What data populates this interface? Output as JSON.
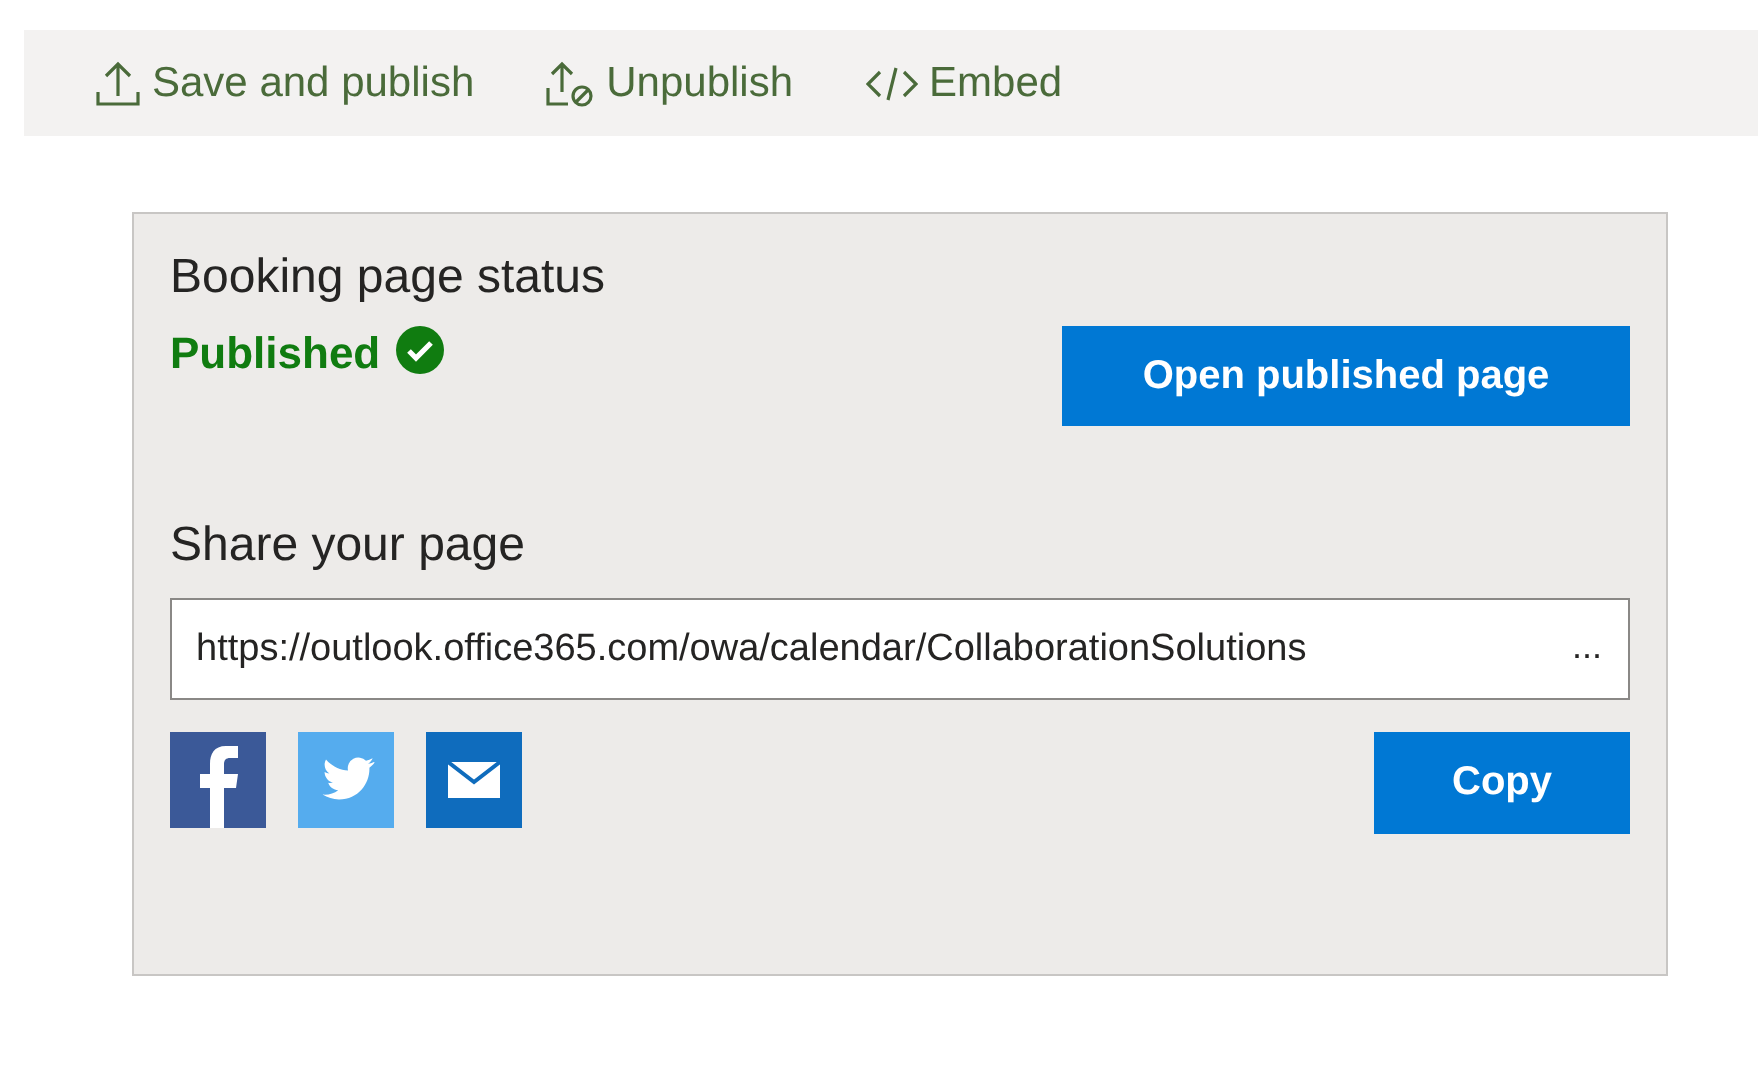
{
  "toolbar": [
    {
      "kind": "upload",
      "label": "Save and publish"
    },
    {
      "kind": "unpublish",
      "label": "Unpublish"
    },
    {
      "kind": "code",
      "label": "Embed"
    }
  ],
  "status_card": {
    "title": "Booking page status",
    "status": "Published",
    "published": true,
    "open_button": "Open published page"
  },
  "share": {
    "title": "Share your page",
    "url": "https://outlook.office365.com/owa/calendar/CollaborationSolutions",
    "more": "...",
    "social": [
      {
        "kind": "facebook"
      },
      {
        "kind": "twitter"
      },
      {
        "kind": "email"
      }
    ],
    "copy_button": "Copy"
  }
}
